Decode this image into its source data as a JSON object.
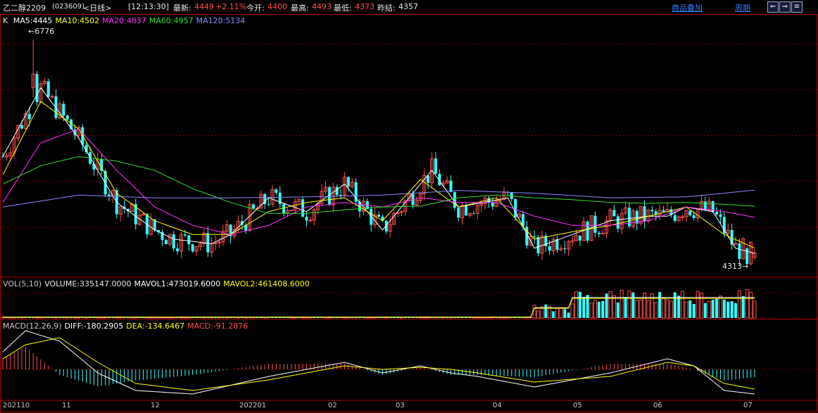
{
  "header": {
    "instrument": "乙二醇2209",
    "code": "(023609)",
    "period_tag": "<日线>",
    "time": "[12:13:30]",
    "last_label": "最新:",
    "last_value": "4449",
    "change": "+2.11%",
    "open_label": "今开:",
    "open_value": "4400",
    "high_label": "最高:",
    "high_value": "4493",
    "low_label": "最低:",
    "low_value": "4373",
    "prev_label": "昨结:",
    "prev_value": "4357",
    "overlay_link": "商品叠加",
    "period_link": "周期",
    "nav_buttons": [
      "⇐",
      "⇒",
      "≡"
    ]
  },
  "ma_legend": {
    "k": "K",
    "items": [
      {
        "text": "MA5:4445",
        "color": "#ffffff"
      },
      {
        "text": "MA10:4502",
        "color": "#ffff00"
      },
      {
        "text": "MA20:4837",
        "color": "#ff33ff"
      },
      {
        "text": "MA60:4957",
        "color": "#33dd33"
      },
      {
        "text": "MA120:5134",
        "color": "#8a8aff"
      }
    ]
  },
  "vol_legend": {
    "items": [
      {
        "text": "VOL(5,10)",
        "color": "#c8c8c8"
      },
      {
        "text": "VOLUME:335147.0000",
        "color": "#e8e8e8"
      },
      {
        "text": "MAVOL1:473019.6000",
        "color": "#ffffff"
      },
      {
        "text": "MAVOL2:461408.6000",
        "color": "#ffff00"
      }
    ]
  },
  "macd_legend": {
    "items": [
      {
        "text": "MACD(12,26,9)",
        "color": "#c8c8c8"
      },
      {
        "text": "DIFF:-180.2905",
        "color": "#ffffff"
      },
      {
        "text": "DEA:-134.6467",
        "color": "#ffff00"
      },
      {
        "text": "MACD:-91.2876",
        "color": "#ff5050"
      }
    ]
  },
  "annotations": {
    "high": "←6776",
    "low": "4313→"
  },
  "x_axis": {
    "labels": [
      "202110",
      "11",
      "12",
      "202201",
      "02",
      "03",
      "04",
      "05",
      "06",
      "07"
    ]
  },
  "colors": {
    "up": "#ff4d4d",
    "down": "#33ffff",
    "grid": "#7a0000",
    "border": "#b00000"
  },
  "chart_data": {
    "type": "candlestick",
    "title": "",
    "ylim": [
      4200,
      6900
    ],
    "series": [
      {
        "name": "MA5",
        "x": [
          0,
          10,
          20,
          30,
          40,
          45,
          55,
          60,
          70,
          80,
          90,
          100,
          107,
          113,
          120,
          133,
          140,
          150,
          160,
          170,
          175,
          180,
          187,
          193,
          198
        ],
        "values": [
          5500,
          6250,
          5700,
          5000,
          4700,
          4600,
          4550,
          4650,
          5050,
          4900,
          5200,
          4700,
          5050,
          5350,
          4950,
          5050,
          4500,
          4650,
          4800,
          4850,
          4850,
          4950,
          4900,
          4500,
          4445
        ]
      },
      {
        "name": "MA10",
        "x": [
          0,
          10,
          20,
          30,
          40,
          50,
          60,
          70,
          80,
          90,
          100,
          110,
          120,
          130,
          140,
          150,
          160,
          170,
          180,
          190,
          198
        ],
        "values": [
          5300,
          6100,
          5800,
          5100,
          4800,
          4650,
          4650,
          4900,
          5000,
          5050,
          4800,
          5250,
          4950,
          5050,
          4600,
          4680,
          4750,
          4850,
          4950,
          4650,
          4502
        ]
      },
      {
        "name": "MA20",
        "x": [
          0,
          10,
          20,
          30,
          40,
          50,
          60,
          70,
          80,
          90,
          100,
          110,
          120,
          130,
          140,
          150,
          160,
          170,
          180,
          190,
          198
        ],
        "values": [
          5000,
          5650,
          5800,
          5350,
          4950,
          4750,
          4650,
          4750,
          4950,
          5000,
          4950,
          5050,
          5000,
          5000,
          4850,
          4750,
          4750,
          4800,
          4950,
          4900,
          4837
        ]
      },
      {
        "name": "MA60",
        "x": [
          0,
          10,
          20,
          30,
          40,
          50,
          60,
          70,
          80,
          90,
          100,
          110,
          120,
          130,
          140,
          150,
          160,
          170,
          180,
          190,
          198
        ],
        "values": [
          5200,
          5400,
          5500,
          5450,
          5350,
          5150,
          5000,
          4880,
          4880,
          4920,
          4950,
          4960,
          5050,
          5080,
          5050,
          5030,
          5000,
          4990,
          5000,
          4980,
          4957
        ]
      },
      {
        "name": "MA120",
        "x": [
          0,
          20,
          40,
          60,
          80,
          100,
          120,
          140,
          160,
          180,
          198
        ],
        "values": [
          4950,
          5080,
          5050,
          5050,
          5060,
          5080,
          5130,
          5100,
          5050,
          5060,
          5134
        ]
      }
    ],
    "candles_anchor": {
      "days": 199,
      "high": 6776,
      "low": 4313,
      "last": {
        "open": 4400,
        "high": 4493,
        "low": 4373,
        "close": 4449
      }
    },
    "volume": {
      "last": 335147,
      "mavol1": 473019.6,
      "mavol2": 461408.6
    },
    "macd": {
      "diff": -180.2905,
      "dea": -134.6467,
      "macd": -91.2876
    },
    "x_ticks": [
      "202110",
      "11",
      "12",
      "202201",
      "02",
      "03",
      "04",
      "05",
      "06",
      "07"
    ]
  }
}
